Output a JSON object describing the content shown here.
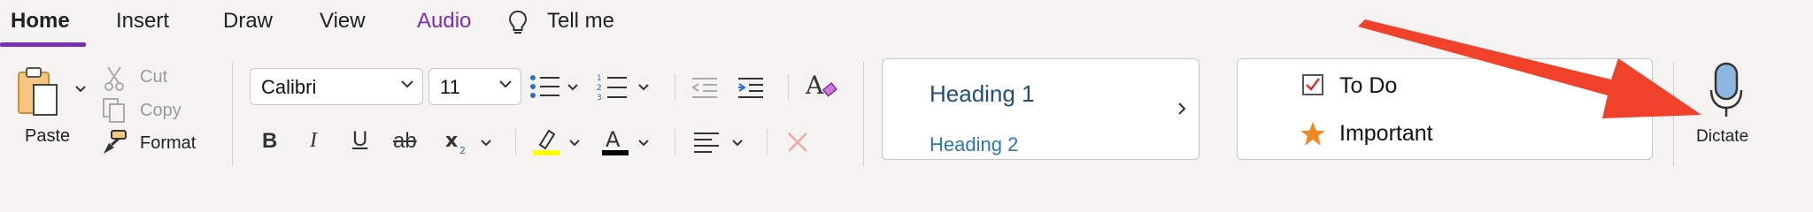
{
  "tabs": [
    {
      "label": "Home",
      "active": true
    },
    {
      "label": "Insert"
    },
    {
      "label": "Draw"
    },
    {
      "label": "View"
    },
    {
      "label": "Audio",
      "color": "#7b2fb0"
    },
    {
      "label": "Tell me"
    }
  ],
  "clipboard": {
    "paste_label": "Paste",
    "cut_label": "Cut",
    "copy_label": "Copy",
    "format_label": "Format"
  },
  "font": {
    "family": "Calibri",
    "size": "11"
  },
  "styles": {
    "heading1": "Heading 1",
    "heading2": "Heading 2"
  },
  "tags": {
    "todo": "To Do",
    "important": "Important"
  },
  "voice": {
    "dictate_label": "Dictate"
  },
  "colors": {
    "accent": "#7b2fb0",
    "highlight": "#ffff00",
    "font_color": "#000000",
    "heading": "#1f4e79",
    "arrow": "#f0412a",
    "mic": "#8fb8e0"
  },
  "icons": [
    "lightbulb-icon",
    "paste-icon",
    "scissors-icon",
    "copy-icon",
    "format-painter-icon",
    "bullets-icon",
    "numbering-icon",
    "decrease-indent-icon",
    "increase-indent-icon",
    "clear-formatting-icon",
    "bold-icon",
    "italic-icon",
    "underline-icon",
    "strikethrough-icon",
    "subscript-icon",
    "highlight-icon",
    "font-color-icon",
    "align-icon",
    "delete-icon",
    "checkbox-icon",
    "star-icon",
    "microphone-icon"
  ]
}
